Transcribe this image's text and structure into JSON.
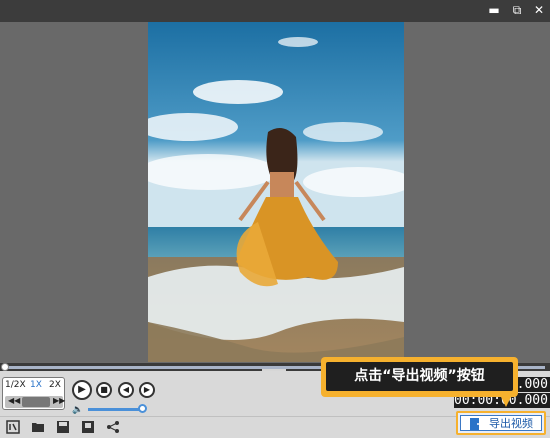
{
  "window": {
    "restore_glyph": "⧉",
    "close_glyph": "✕"
  },
  "video": {
    "description_icon": "image-frame-icon"
  },
  "playback": {
    "speeds": [
      "1/2X",
      "1X",
      "2X"
    ],
    "selected_speed": "1X",
    "time_current": "00:00:00.000",
    "time_total": "00:00:00.000"
  },
  "toolbar": {
    "icons": [
      "edit-icon",
      "folder-open-icon",
      "save-icon",
      "save-as-icon",
      "share-icon"
    ]
  },
  "export": {
    "label": "导出视频"
  },
  "callout": {
    "text": "点击“导出视频”按钮"
  },
  "colors": {
    "accent": "#f6b12e",
    "blue": "#4a90d9"
  }
}
